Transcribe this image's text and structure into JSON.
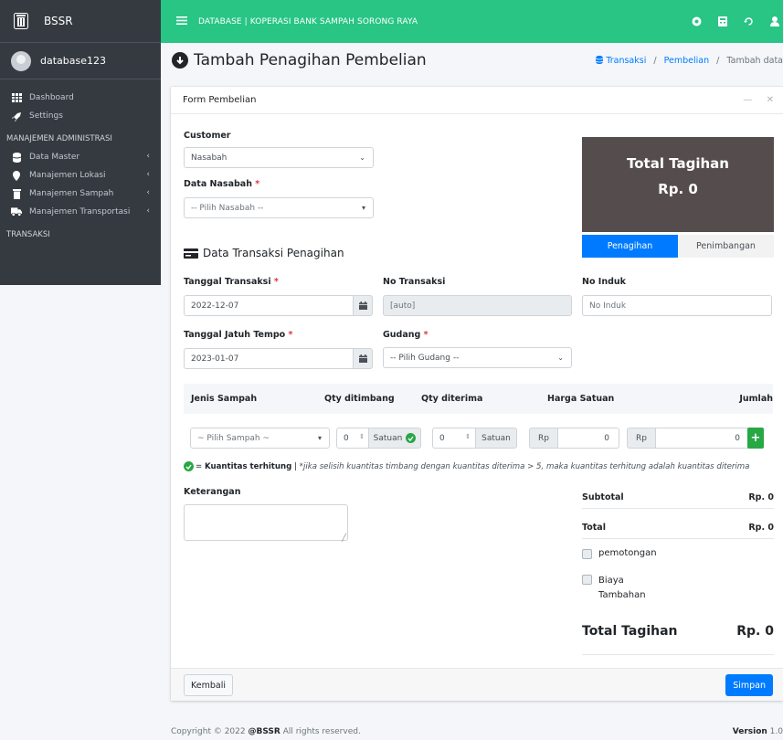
{
  "brand": {
    "name": "BSSR"
  },
  "user": {
    "name": "database123"
  },
  "sidebar": {
    "items": [
      {
        "label": "Dashboard"
      },
      {
        "label": "Settings"
      }
    ],
    "header_admin": "MANAJEMEN ADMINISTRASI",
    "admin_items": [
      {
        "label": "Data Master"
      },
      {
        "label": "Manajemen Lokasi"
      },
      {
        "label": "Manajemen Sampah"
      },
      {
        "label": "Manajemen Transportasi"
      }
    ],
    "header_transaksi": "TRANSAKSI"
  },
  "topbar": {
    "title": "DATABASE | KOPERASI BANK SAMPAH SORONG RAYA"
  },
  "page": {
    "title": "Tambah Penagihan Pembelian"
  },
  "breadcrumb": {
    "item1": "Transaksi",
    "item2": "Pembelian",
    "current": "Tambah data"
  },
  "card": {
    "title": "Form Pembelian"
  },
  "form": {
    "customer_label": "Customer",
    "customer_value": "Nasabah",
    "nasabah_label": "Data Nasabah",
    "nasabah_placeholder": "-- Pilih Nasabah --",
    "section_title": "Data Transaksi Penagihan",
    "tanggal_label": "Tanggal Transaksi",
    "tanggal_value": "2022-12-07",
    "no_transaksi_label": "No Transaksi",
    "no_transaksi_value": "[auto]",
    "no_induk_label": "No Induk",
    "no_induk_placeholder": "No Induk",
    "jatuh_tempo_label": "Tanggal Jatuh Tempo",
    "jatuh_tempo_value": "2023-01-07",
    "gudang_label": "Gudang",
    "gudang_placeholder": "-- Pilih Gudang --",
    "required_mark": "*"
  },
  "total_box": {
    "label": "Total Tagihan",
    "value": "Rp. 0"
  },
  "tabs": {
    "active": "Penagihan",
    "inactive": "Penimbangan"
  },
  "table": {
    "headers": {
      "jenis": "Jenis Sampah",
      "qty_timbang": "Qty ditimbang",
      "qty_terima": "Qty diterima",
      "harga": "Harga Satuan",
      "jumlah": "Jumlah"
    },
    "row": {
      "sampah_placeholder": "~ Pilih Sampah ~",
      "qty_timbang": "0",
      "satuan1": "Satuan",
      "qty_terima": "0",
      "satuan2": "Satuan",
      "rp1": "Rp",
      "harga": "0",
      "rp2": "Rp",
      "jumlah": "0"
    }
  },
  "note": {
    "bold": "Kuantitas terhitung",
    "prefix": "= ",
    "sep": " | ",
    "italic": "*jika selisih kuantitas timbang dengan kuantitas diterima > 5, maka kuantitas terhitung adalah kuantitas diterima"
  },
  "keterangan": {
    "label": "Keterangan"
  },
  "summary": {
    "subtotal_label": "Subtotal",
    "subtotal_value": "Rp. 0",
    "total_label": "Total",
    "total_value": "Rp. 0",
    "pemotongan_label": "pemotongan",
    "biaya_line1": "Biaya",
    "biaya_line2": "Tambahan",
    "grand_label": "Total Tagihan",
    "grand_value": "Rp. 0"
  },
  "footer_buttons": {
    "back": "Kembali",
    "save": "Simpan"
  },
  "footer": {
    "copyright": "Copyright © 2022 ",
    "brand": "@BSSR",
    "rights": " All rights reserved.",
    "version_label": "Version",
    "version_value": " 1.0"
  },
  "colors": {
    "topbar": "#28c585",
    "sidebar": "#343a40",
    "total_box": "#554c4d",
    "primary": "#007bff",
    "success": "#28a745"
  }
}
